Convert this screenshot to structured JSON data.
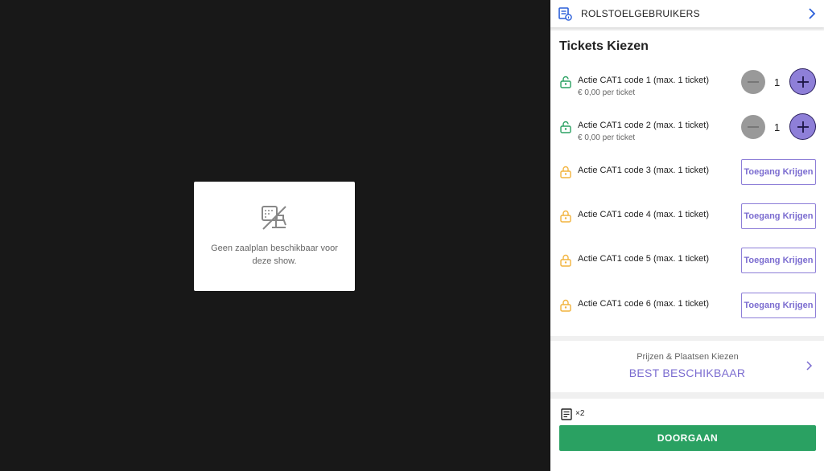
{
  "map": {
    "message": "Geen zaalplan beschikbaar voor deze show.",
    "icon": "no-seatmap-icon"
  },
  "header": {
    "title": "ROLSTOELGEBRUIKERS",
    "icon": "document-icon"
  },
  "tickets": {
    "heading": "Tickets Kiezen",
    "items": [
      {
        "name": "Actie CAT1 code 1 (max. 1 ticket)",
        "price": "€ 0,00 per ticket",
        "quantity": "1",
        "unlocked": true
      },
      {
        "name": "Actie CAT1 code 2 (max. 1 ticket)",
        "price": "€ 0,00 per ticket",
        "quantity": "1",
        "unlocked": true
      },
      {
        "name": "Actie CAT1 code 3 (max. 1 ticket)",
        "access_label": "Toegang Krijgen",
        "unlocked": false
      },
      {
        "name": "Actie CAT1 code 4 (max. 1 ticket)",
        "access_label": "Toegang Krijgen",
        "unlocked": false
      },
      {
        "name": "Actie CAT1 code 5 (max. 1 ticket)",
        "access_label": "Toegang Krijgen",
        "unlocked": false
      },
      {
        "name": "Actie CAT1 code 6 (max. 1 ticket)",
        "access_label": "Toegang Krijgen",
        "unlocked": false
      }
    ]
  },
  "prices": {
    "label": "Prijzen & Plaatsen Kiezen",
    "value": "BEST BESCHIKBAAR"
  },
  "footer": {
    "count": "×2",
    "continue_label": "DOORGAAN"
  },
  "colors": {
    "accent": "#8e7fd8",
    "unlocked": "#2aa162",
    "locked": "#f2b33d",
    "continue": "#2aa162"
  }
}
